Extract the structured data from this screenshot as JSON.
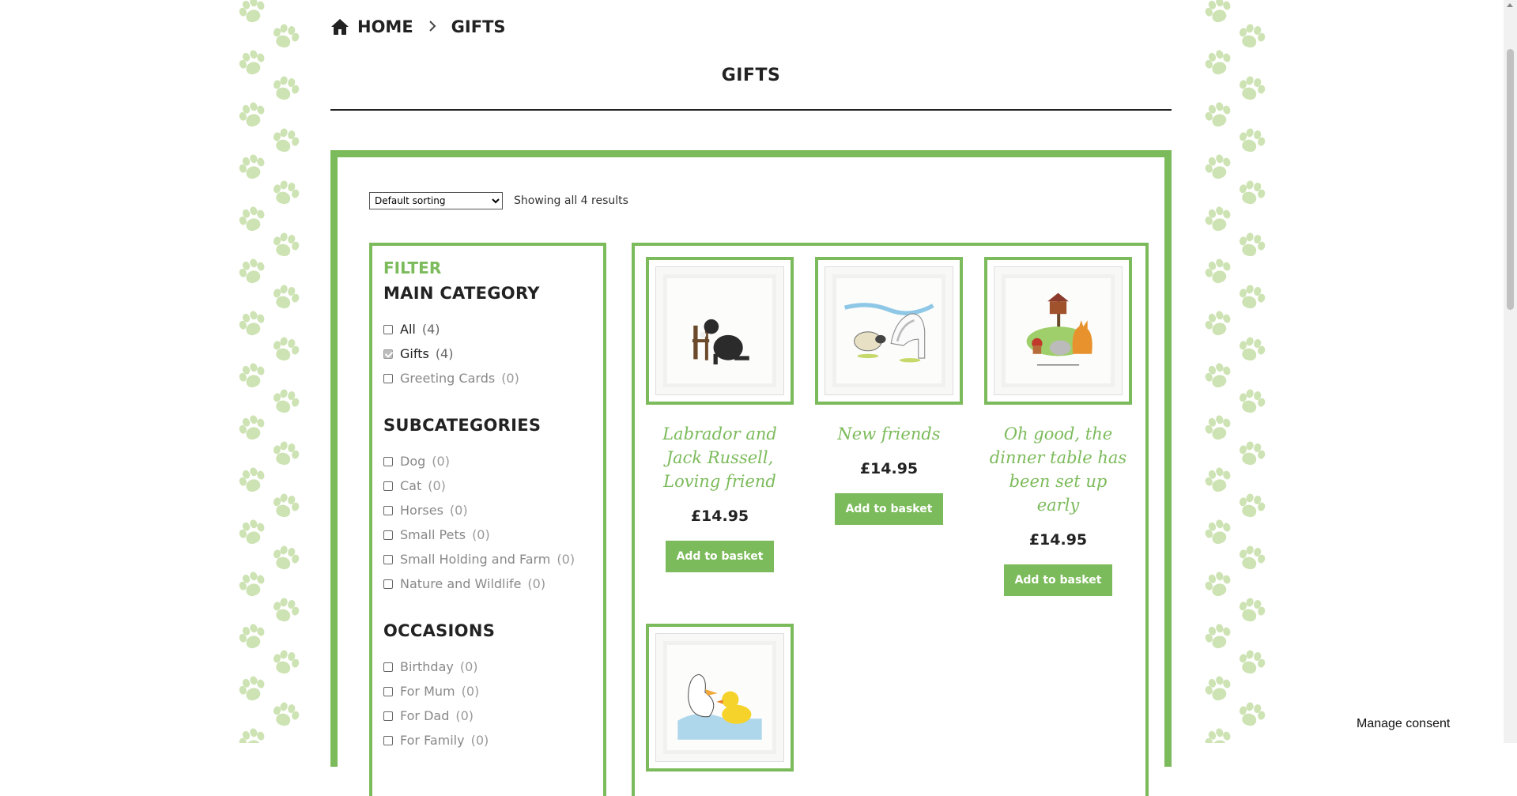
{
  "breadcrumb": {
    "home_label": "HOME",
    "current_label": "GIFTS",
    "home_icon": "home-icon",
    "separator_icon": "chevron-right-icon"
  },
  "page": {
    "title": "GIFTS"
  },
  "toolbar": {
    "sort_selected": "Default sorting",
    "results_text": "Showing all 4 results"
  },
  "filter": {
    "heading": "FILTER",
    "groups": [
      {
        "title": "MAIN CATEGORY",
        "options": [
          {
            "label": "All",
            "count": "(4)",
            "checked": false,
            "active": true
          },
          {
            "label": "Gifts",
            "count": "(4)",
            "checked": true,
            "active": true
          },
          {
            "label": "Greeting Cards",
            "count": "(0)",
            "checked": false,
            "active": false
          }
        ]
      },
      {
        "title": "SUBCATEGORIES",
        "options": [
          {
            "label": "Dog",
            "count": "(0)"
          },
          {
            "label": "Cat",
            "count": "(0)"
          },
          {
            "label": "Horses",
            "count": "(0)"
          },
          {
            "label": "Small Pets",
            "count": "(0)"
          },
          {
            "label": "Small Holding and Farm",
            "count": "(0)"
          },
          {
            "label": "Nature and Wildlife",
            "count": "(0)"
          }
        ]
      },
      {
        "title": "OCCASIONS",
        "options": [
          {
            "label": "Birthday",
            "count": "(0)"
          },
          {
            "label": "For Mum",
            "count": "(0)"
          },
          {
            "label": "For Dad",
            "count": "(0)"
          },
          {
            "label": "For Family",
            "count": "(0)"
          }
        ]
      }
    ]
  },
  "products": [
    {
      "name": "Labrador and Jack Russell, Loving friend",
      "price": "£14.95",
      "button": "Add to basket"
    },
    {
      "name": "New friends",
      "price": "£14.95",
      "button": "Add to basket"
    },
    {
      "name": "Oh good, the dinner table has been set up early",
      "price": "£14.95",
      "button": "Add to basket"
    },
    {
      "name": "",
      "price": "",
      "button": ""
    }
  ],
  "consent": {
    "label": "Manage consent"
  },
  "colors": {
    "accent": "#7cbb5b",
    "paw": "#cde3b3",
    "text": "#222222"
  }
}
